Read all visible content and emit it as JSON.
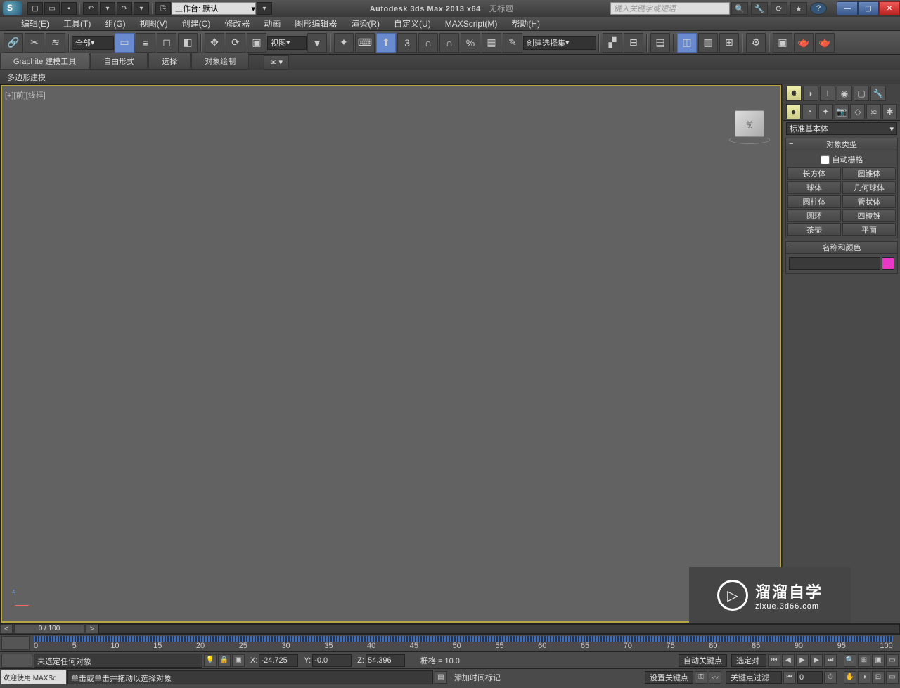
{
  "titlebar": {
    "workspace_label": "工作台: 默认",
    "app_title": "Autodesk 3ds Max  2013 x64",
    "doc_title": "无标题",
    "search_placeholder": "键入关键字或短语"
  },
  "menu": {
    "items": [
      "编辑(E)",
      "工具(T)",
      "组(G)",
      "视图(V)",
      "创建(C)",
      "修改器",
      "动画",
      "图形编辑器",
      "渲染(R)",
      "自定义(U)",
      "MAXScript(M)",
      "帮助(H)"
    ]
  },
  "toolbar": {
    "filter_all": "全部",
    "ref_dd": "视图",
    "named_sel": "创建选择集"
  },
  "ribbon": {
    "tabs": [
      "Graphite 建模工具",
      "自由形式",
      "选择",
      "对象绘制"
    ],
    "sub": "多边形建模"
  },
  "viewport": {
    "label": "[+][前][线框]",
    "cube_face": "前"
  },
  "cmd_panel": {
    "category": "标准基本体",
    "rollout_obj_type": "对象类型",
    "auto_grid": "自动栅格",
    "buttons": [
      "长方体",
      "圆锥体",
      "球体",
      "几何球体",
      "圆柱体",
      "管状体",
      "圆环",
      "四棱锥",
      "茶壶",
      "平面"
    ],
    "rollout_name_color": "名称和颜色"
  },
  "timeline": {
    "frame_display": "0 / 100",
    "ticks": [
      "0",
      "5",
      "10",
      "15",
      "20",
      "25",
      "30",
      "35",
      "40",
      "45",
      "50",
      "55",
      "60",
      "65",
      "70",
      "75",
      "80",
      "85",
      "90",
      "95",
      "100"
    ]
  },
  "status": {
    "selection": "未选定任何对象",
    "x": "-24.725",
    "y": "-0.0",
    "z": "54.396",
    "grid": "栅格 = 10.0",
    "auto_key": "自动关键点",
    "set_key": "设置关键点",
    "sel_set": "选定对",
    "key_filter": "关键点过滤器...",
    "frame_cur": "0",
    "add_time_tag": "添加时间标记",
    "prompt_welcome": "欢迎使用 MAXSc",
    "prompt_hint": "单击或单击并拖动以选择对象"
  },
  "watermark": {
    "line1": "溜溜自学",
    "line2": "zixue.3d66.com"
  }
}
